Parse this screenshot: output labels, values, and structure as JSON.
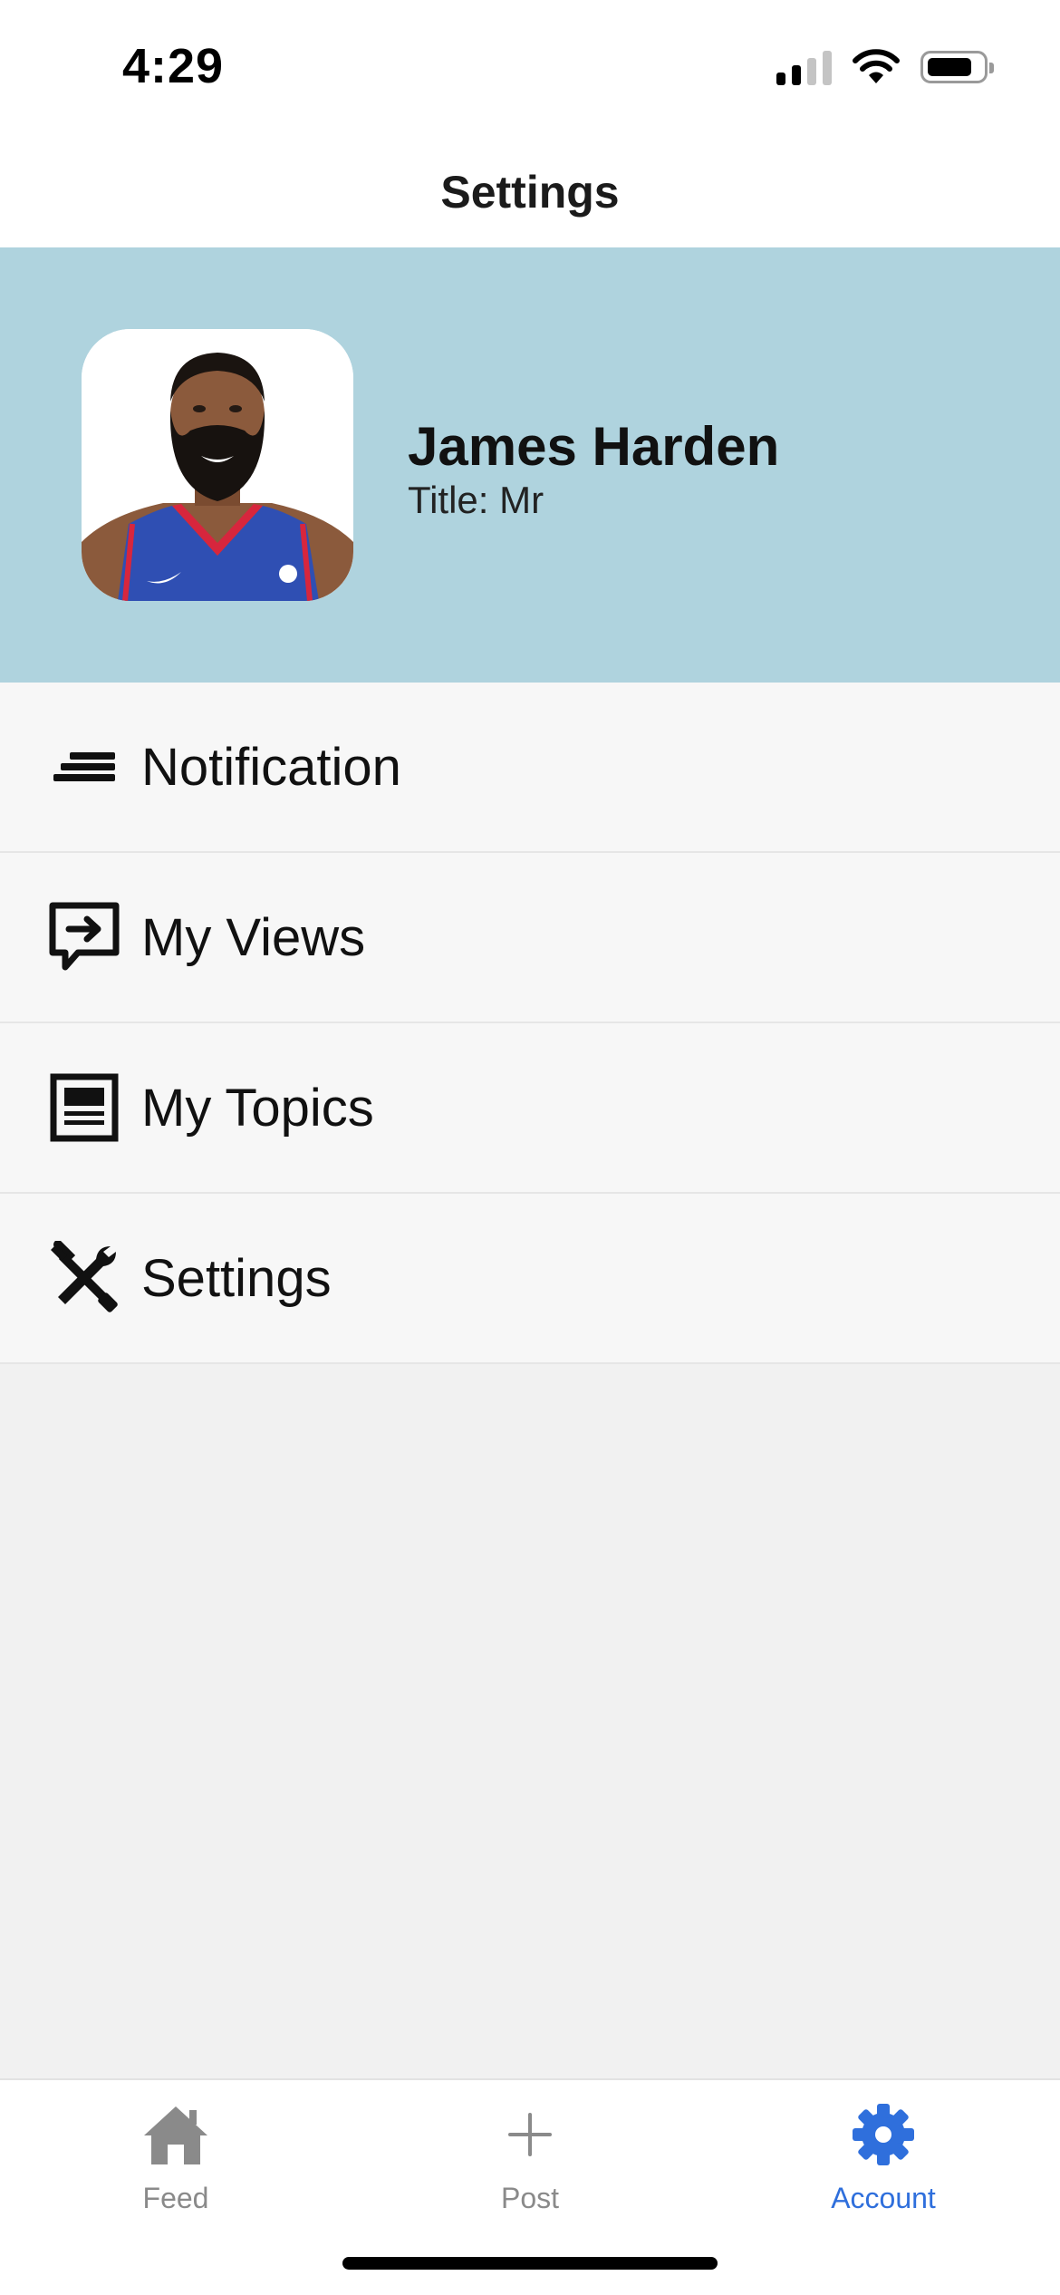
{
  "status_bar": {
    "time": "4:29",
    "signal_icon": "cellular-signal-icon",
    "wifi_icon": "wifi-icon",
    "battery_icon": "battery-icon",
    "battery_level": 0.75
  },
  "nav": {
    "title": "Settings"
  },
  "profile": {
    "name": "James Harden",
    "title": "Title: Mr",
    "avatar_icon": "profile-photo"
  },
  "menu": {
    "items": [
      {
        "label": "Notification",
        "icon": "lines-icon"
      },
      {
        "label": "My Views",
        "icon": "chat-arrow-icon"
      },
      {
        "label": "My Topics",
        "icon": "article-icon"
      },
      {
        "label": "Settings",
        "icon": "tools-icon"
      }
    ]
  },
  "tab_bar": {
    "tabs": [
      {
        "label": "Feed",
        "icon": "home-icon",
        "active": false
      },
      {
        "label": "Post",
        "icon": "plus-icon",
        "active": false
      },
      {
        "label": "Account",
        "icon": "gear-icon",
        "active": true
      }
    ],
    "active_color": "#2f6fdc",
    "inactive_color": "#8a8a8a"
  },
  "colors": {
    "profile_background": "#afd3de",
    "menu_background": "#f7f7f7",
    "page_background": "#f1f1f1"
  }
}
